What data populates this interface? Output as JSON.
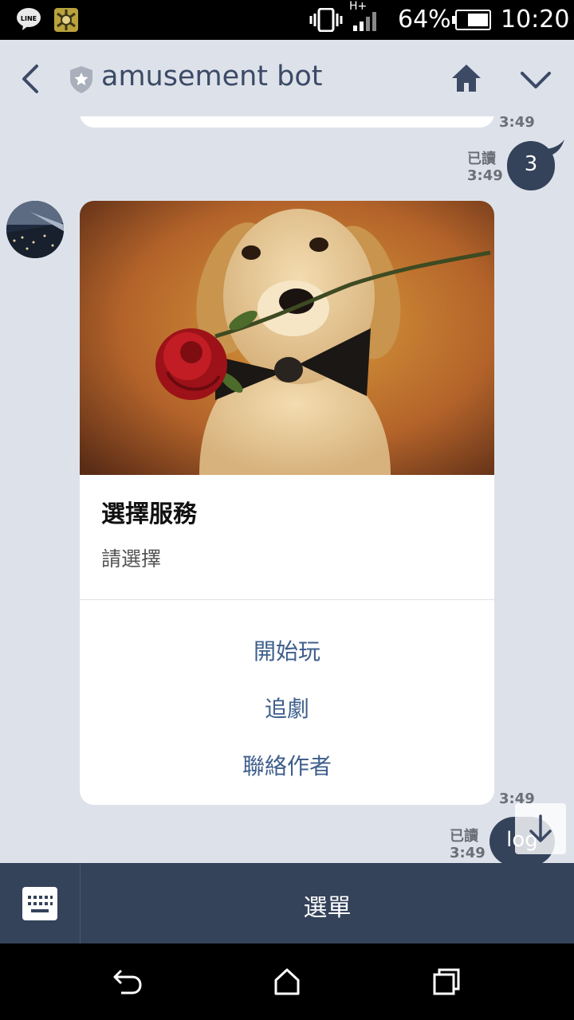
{
  "status_bar": {
    "signal_label": "H+",
    "battery_percent": "64%",
    "time": "10:20",
    "line_icon_text": "LINE"
  },
  "header": {
    "title": "amusement bot"
  },
  "chat": {
    "messages": [
      {
        "type": "received_partial",
        "time": "3:49"
      },
      {
        "type": "sent",
        "read_label": "已讀",
        "time": "3:49",
        "text": "3"
      },
      {
        "type": "received_card",
        "time": "3:49",
        "card": {
          "image_subject": "puppy with rose and bow tie",
          "title": "選擇服務",
          "subtitle": "請選擇",
          "actions": [
            "開始玩",
            "追劇",
            "聯絡作者"
          ]
        }
      },
      {
        "type": "sent",
        "read_label": "已讀",
        "time": "3:49",
        "text": "log"
      }
    ]
  },
  "bottom_bar": {
    "menu_label": "選單"
  },
  "colors": {
    "chat_background": "#dde2ea",
    "sent_bubble": "#34425a",
    "bottom_bar": "#34425a",
    "action_text": "#3f5f8c"
  }
}
